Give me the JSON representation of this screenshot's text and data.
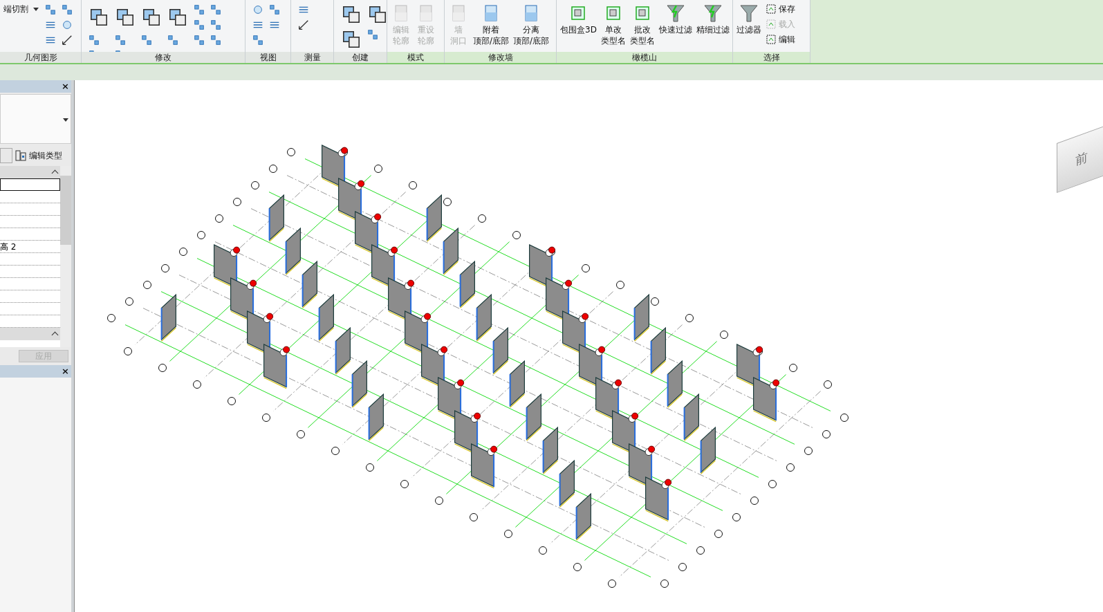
{
  "ribbon": {
    "panels": [
      {
        "title": "几何图形",
        "items": [
          {
            "kind": "small",
            "label": "端切割",
            "disabled": false,
            "dropdown": true
          }
        ]
      },
      {
        "title": "修改"
      },
      {
        "title": "视图"
      },
      {
        "title": "测量"
      },
      {
        "title": "创建"
      },
      {
        "title": "模式",
        "items": [
          {
            "kind": "large",
            "lines": [
              "编辑",
              "轮廓"
            ],
            "disabled": true
          },
          {
            "kind": "large",
            "lines": [
              "重设",
              "轮廓"
            ],
            "disabled": true
          }
        ]
      },
      {
        "title": "修改墙",
        "items": [
          {
            "kind": "large",
            "lines": [
              "墙",
              "洞口"
            ],
            "disabled": true
          },
          {
            "kind": "large",
            "lines": [
              "附着",
              "顶部/底部"
            ],
            "disabled": false
          },
          {
            "kind": "large",
            "lines": [
              "分离",
              "顶部/底部"
            ],
            "disabled": false
          }
        ]
      },
      {
        "title": "橄榄山",
        "items": [
          {
            "kind": "large",
            "lines": [
              "包围盒3D"
            ],
            "disabled": false
          },
          {
            "kind": "large",
            "lines": [
              "单改",
              "类型名"
            ],
            "disabled": false
          },
          {
            "kind": "large",
            "lines": [
              "批改",
              "类型名"
            ],
            "disabled": false
          },
          {
            "kind": "large",
            "lines": [
              "快速过滤"
            ],
            "disabled": false
          },
          {
            "kind": "large",
            "lines": [
              "精细过滤"
            ],
            "disabled": false
          }
        ]
      },
      {
        "title": "选择",
        "items": [
          {
            "kind": "large",
            "lines": [
              "过滤器"
            ],
            "disabled": false
          },
          {
            "kind": "small",
            "label": "保存",
            "disabled": false
          },
          {
            "kind": "small",
            "label": "载入",
            "disabled": true
          },
          {
            "kind": "small",
            "label": "编辑",
            "disabled": false
          }
        ]
      }
    ]
  },
  "properties": {
    "close": "×",
    "edit_type": "编辑类型",
    "rows": [
      {
        "selected": true
      },
      {
        "selected": false
      },
      {
        "selected": false
      },
      {
        "selected": false
      },
      {
        "selected": false
      },
      {
        "selected": false,
        "value": "高 2"
      },
      {
        "selected": false
      },
      {
        "selected": false
      },
      {
        "selected": false
      },
      {
        "selected": false
      },
      {
        "selected": false
      },
      {
        "selected": false
      }
    ],
    "apply": {
      "label": "应用",
      "disabled": true
    }
  },
  "browser": {
    "close": "×"
  },
  "view_cube": {
    "face": "前"
  }
}
